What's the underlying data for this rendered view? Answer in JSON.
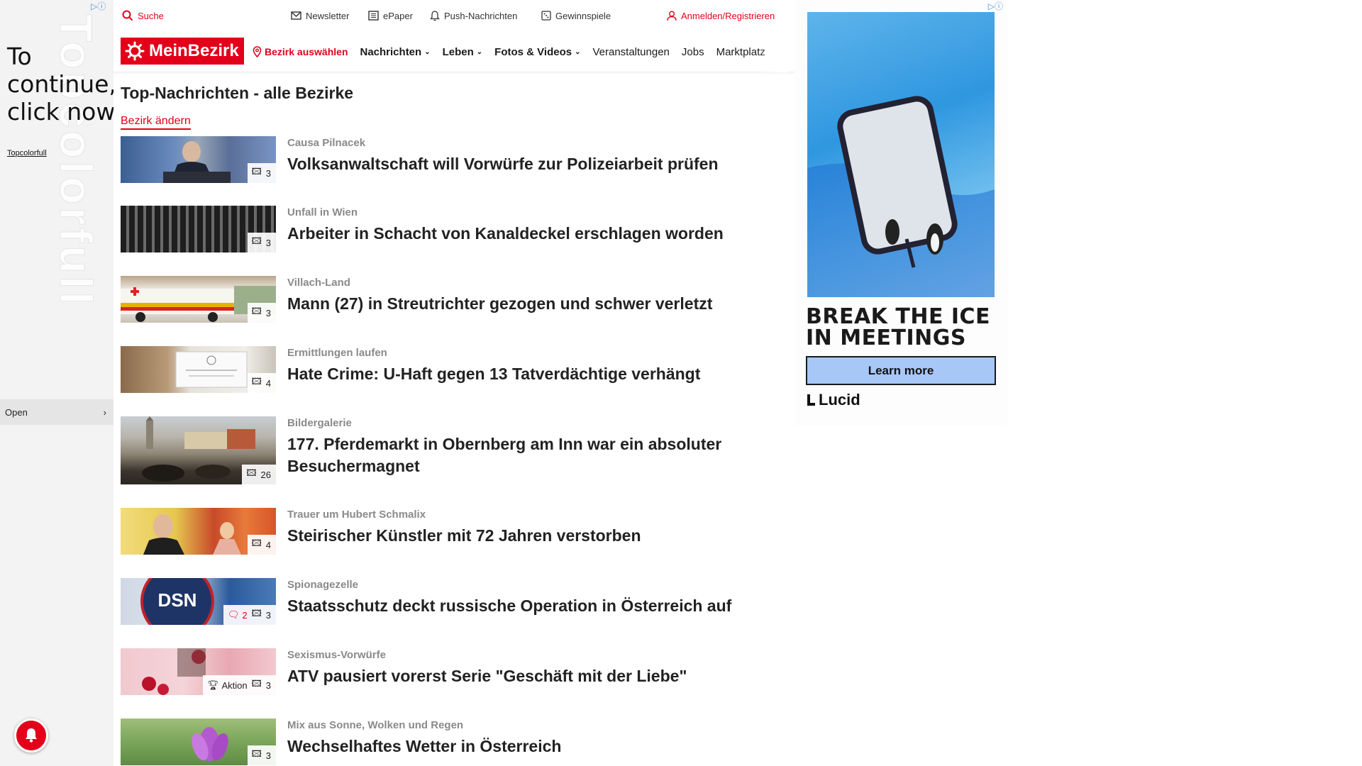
{
  "left_ad": {
    "bg_word": "Topcolorfull",
    "cta": "To continue, click now",
    "brand": "Topcolorfull",
    "open_label": "Open"
  },
  "topbar": {
    "search": "Suche",
    "newsletter": "Newsletter",
    "epaper": "ePaper",
    "push": "Push-Nachrichten",
    "gewinnspiele": "Gewinnspiele",
    "login": "Anmelden/Registrieren"
  },
  "nav": {
    "logo": "MeinBezirk",
    "select_district": "Bezirk auswählen",
    "items": [
      "Nachrichten",
      "Leben",
      "Fotos & Videos",
      "Veranstaltungen",
      "Jobs",
      "Marktplatz"
    ]
  },
  "main": {
    "title": "Top-Nachrichten - alle Bezirke",
    "change_district": "Bezirk ändern"
  },
  "articles": [
    {
      "kicker": "Causa Pilnacek",
      "headline": "Volksanwaltschaft will Vorwürfe zur Polizeiarbeit prüfen",
      "images": "3"
    },
    {
      "kicker": "Unfall in Wien",
      "headline": "Arbeiter in Schacht von Kanaldeckel erschlagen worden",
      "images": "3"
    },
    {
      "kicker": "Villach-Land",
      "headline": "Mann (27) in Streutrichter gezogen und schwer verletzt",
      "images": "3"
    },
    {
      "kicker": "Ermittlungen laufen",
      "headline": "Hate Crime: U-Haft gegen 13 Tatverdächtige verhängt",
      "images": "4"
    },
    {
      "kicker": "Bildergalerie",
      "headline": "177. Pferdemarkt in Obernberg am Inn war ein absoluter Besuchermagnet",
      "images": "26"
    },
    {
      "kicker": "Trauer um Hubert Schmalix",
      "headline": "Steirischer Künstler mit 72 Jahren verstorben",
      "images": "4"
    },
    {
      "kicker": "Spionagezelle",
      "headline": "Staatsschutz deckt russische Operation in Österreich auf",
      "images": "3",
      "comments": "2",
      "thumb_text": "DSN"
    },
    {
      "kicker": "Sexismus-Vorwürfe",
      "headline": "ATV pausiert vorerst Serie \"Geschäft mit der Liebe\"",
      "images": "3",
      "promo": "Aktion"
    },
    {
      "kicker": "Mix aus Sonne, Wolken und Regen",
      "headline": "Wechselhaftes Wetter in Österreich",
      "images": "3"
    }
  ],
  "right_ad": {
    "headline_line1": "BREAK THE ICE",
    "headline_line2": "IN MEETINGS",
    "button": "Learn more",
    "brand": "Lucid"
  },
  "colors": {
    "brand_red": "#e2001a",
    "ad_button": "#a7c7f6",
    "muted_kicker": "#8a8a8a"
  }
}
